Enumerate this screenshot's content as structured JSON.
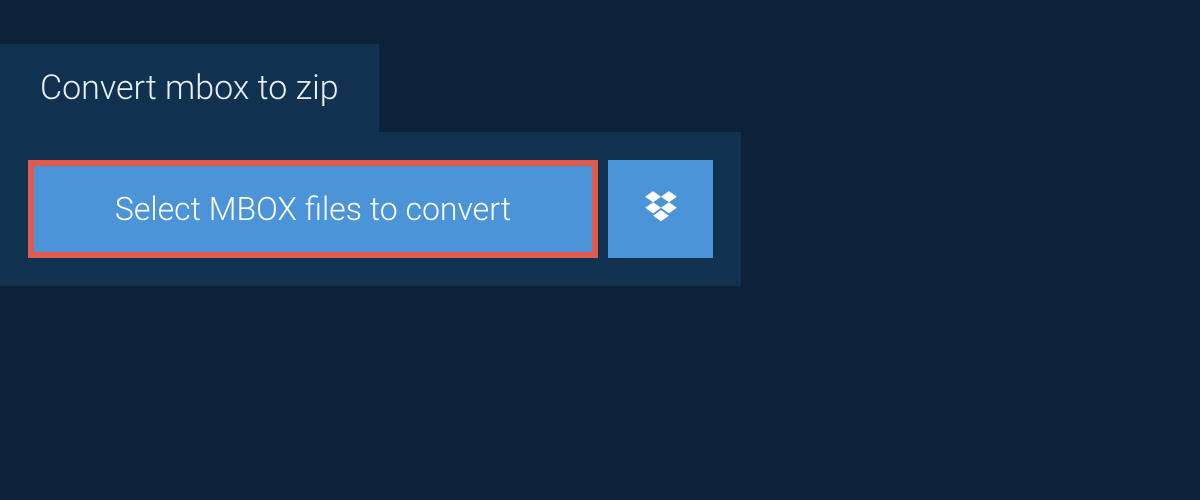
{
  "tab": {
    "label": "Convert mbox to zip"
  },
  "actions": {
    "select_label": "Select MBOX files to convert"
  }
}
